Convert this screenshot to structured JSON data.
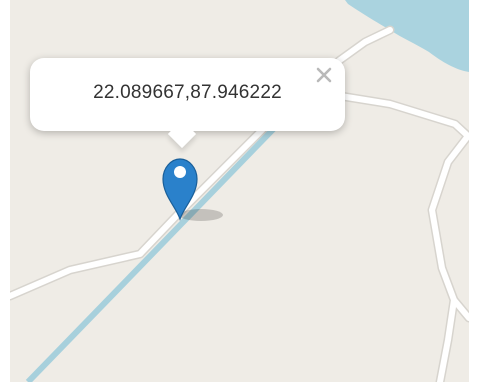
{
  "map": {
    "colors": {
      "land": "#efece6",
      "water": "#aad3df",
      "road": "#ffffff",
      "road_casing": "#d7d4ce",
      "canal": "#a7d0dc",
      "marker": "#2a81cb",
      "marker_dark": "#1a5f99"
    }
  },
  "popup": {
    "coordinates_text": "22.089667,87.946222",
    "close_glyph": "×"
  },
  "marker": {
    "icon": "map-pin-icon"
  }
}
